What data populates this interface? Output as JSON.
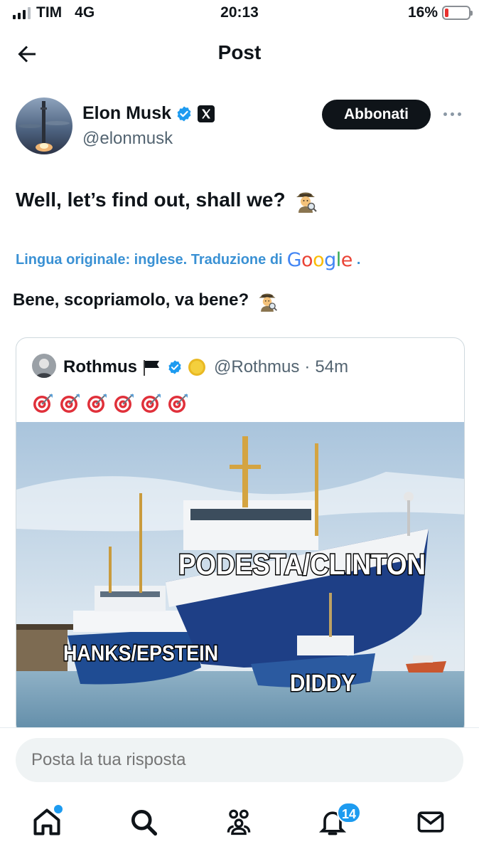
{
  "status_bar": {
    "carrier": "TIM",
    "network": "4G",
    "time": "20:13",
    "battery": "16%",
    "battery_level": 0.16,
    "battery_color": "#e8312f"
  },
  "header": {
    "title": "Post",
    "back_icon": "arrow-left-icon"
  },
  "post": {
    "author_name": "Elon Musk",
    "author_handle": "@elonmusk",
    "verified_color": "#1d9bf0",
    "subscribe_label": "Abbonati",
    "text": "Well, let’s find out, shall we?",
    "translation_label": "Lingua originale: inglese. Traduzione di",
    "translation_provider": "Google",
    "translated_text": "Bene, scopriamolo, va bene?",
    "emoji_icon": "detective-icon"
  },
  "quote": {
    "author_name": "Rothmus",
    "author_handle": "@Rothmus",
    "separator": "·",
    "time_ago": "54m",
    "target_count": 6,
    "image": {
      "labels": {
        "big_ship": "PODESTA/CLINTON",
        "medium_ship": "HANKS/EPSTEIN",
        "small_boat": "DIDDY"
      }
    }
  },
  "reply": {
    "placeholder": "Posta la tua risposta"
  },
  "tab_bar": {
    "items": [
      "home-icon",
      "search-icon",
      "communities-icon",
      "notifications-icon",
      "messages-icon"
    ],
    "notifications_badge": "14",
    "accent": "#1d9bf0"
  }
}
